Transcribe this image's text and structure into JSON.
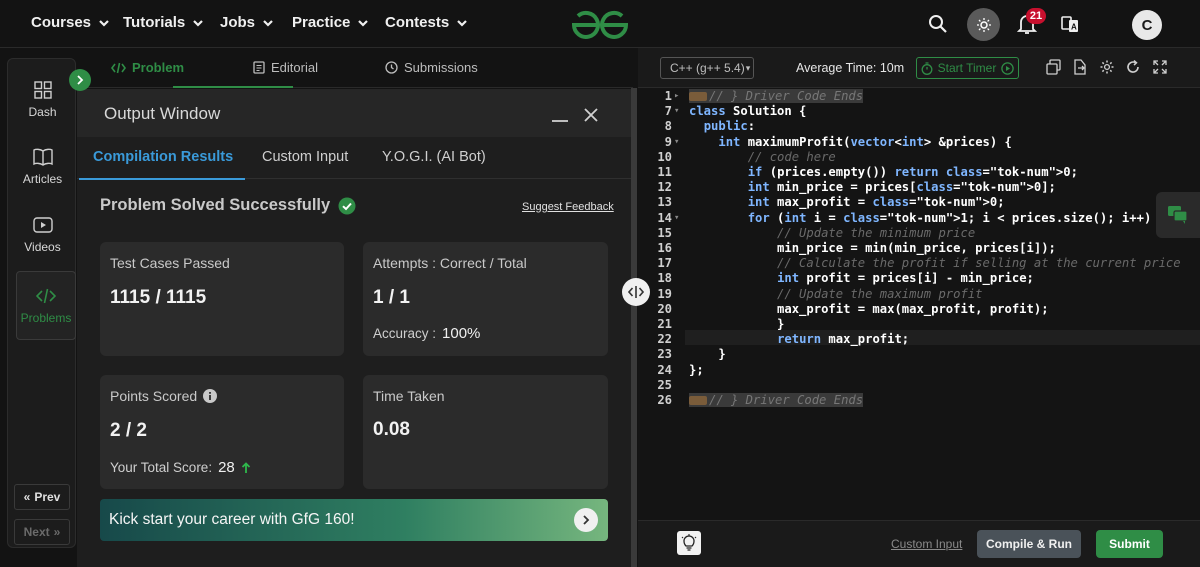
{
  "topnav": {
    "items": [
      "Courses",
      "Tutorials",
      "Jobs",
      "Practice",
      "Contests"
    ],
    "notification_count": "21",
    "avatar_letter": "C"
  },
  "rail": {
    "items": [
      "Dash",
      "Articles",
      "Videos",
      "Problems"
    ],
    "prev_label": "Prev",
    "next_label": "Next"
  },
  "problem_tabs": [
    "Problem",
    "Editorial",
    "Submissions"
  ],
  "output": {
    "title": "Output Window",
    "tabs": [
      "Compilation Results",
      "Custom Input",
      "Y.O.G.I. (AI Bot)"
    ],
    "status": "Problem Solved Successfully",
    "suggest_feedback": "Suggest Feedback",
    "cards": {
      "test_cases": {
        "label": "Test Cases Passed",
        "value": "1115 / 1115"
      },
      "attempts": {
        "label": "Attempts : Correct / Total",
        "value": "1 / 1",
        "accuracy_label": "Accuracy :",
        "accuracy_value": "100%"
      },
      "points": {
        "label": "Points Scored",
        "value": "2 / 2",
        "total_label": "Your Total Score:",
        "total_value": "28"
      },
      "time": {
        "label": "Time Taken",
        "value": "0.08"
      }
    },
    "banner": "Kick start your career with GfG 160!"
  },
  "editor": {
    "language": "C++ (g++ 5.4)",
    "average_time": "Average Time: 10m",
    "start_timer": "Start Timer",
    "custom_input": "Custom Input",
    "compile_run": "Compile & Run",
    "submit": "Submit",
    "lines": [
      {
        "n": "1",
        "fold": "▸",
        "code": "// } Driver Code Ends",
        "type": "folded"
      },
      {
        "n": "7",
        "fold": "▾",
        "code": "class Solution {",
        "type": "code"
      },
      {
        "n": "8",
        "fold": "",
        "code": "  public:",
        "type": "code"
      },
      {
        "n": "9",
        "fold": "▾",
        "code": "    int maximumProfit(vector<int> &prices) {",
        "type": "code"
      },
      {
        "n": "10",
        "fold": "",
        "code": "        // code here",
        "type": "comment"
      },
      {
        "n": "11",
        "fold": "",
        "code": "        if (prices.empty()) return 0;",
        "type": "code"
      },
      {
        "n": "12",
        "fold": "",
        "code": "        int min_price = prices[0];",
        "type": "code"
      },
      {
        "n": "13",
        "fold": "",
        "code": "        int max_profit = 0;",
        "type": "code"
      },
      {
        "n": "14",
        "fold": "▾",
        "code": "        for (int i = 1; i < prices.size(); i++) {",
        "type": "code"
      },
      {
        "n": "15",
        "fold": "",
        "code": "            // Update the minimum price",
        "type": "comment"
      },
      {
        "n": "16",
        "fold": "",
        "code": "            min_price = min(min_price, prices[i]);",
        "type": "code"
      },
      {
        "n": "17",
        "fold": "",
        "code": "            // Calculate the profit if selling at the current price",
        "type": "comment"
      },
      {
        "n": "18",
        "fold": "",
        "code": "            int profit = prices[i] - min_price;",
        "type": "code"
      },
      {
        "n": "19",
        "fold": "",
        "code": "            // Update the maximum profit",
        "type": "comment"
      },
      {
        "n": "20",
        "fold": "",
        "code": "            max_profit = max(max_profit, profit);",
        "type": "code"
      },
      {
        "n": "21",
        "fold": "",
        "code": "            }",
        "type": "code"
      },
      {
        "n": "22",
        "fold": "",
        "code": "            return max_profit;",
        "type": "code"
      },
      {
        "n": "23",
        "fold": "",
        "code": "    }",
        "type": "code"
      },
      {
        "n": "24",
        "fold": "",
        "code": "};",
        "type": "code"
      },
      {
        "n": "25",
        "fold": "",
        "code": "",
        "type": "code"
      },
      {
        "n": "26",
        "fold": "",
        "code": "// } Driver Code Ends",
        "type": "folded"
      }
    ]
  },
  "colors": {
    "brand_green": "#2f8d46",
    "tab_blue": "#3a9ad9",
    "badge_red": "#c8102e"
  },
  "icons": [
    "chevron-down-icon",
    "search-icon",
    "sun-icon",
    "bell-icon",
    "translate-icon",
    "grid-icon",
    "book-icon",
    "play-icon",
    "code-icon",
    "info-icon",
    "check-circle-icon",
    "arrow-up-icon",
    "chevron-right-icon",
    "copy-icon",
    "export-icon",
    "gear-icon",
    "refresh-icon",
    "fullscreen-icon",
    "lightbulb-icon",
    "chat-icon",
    "clock-icon"
  ]
}
